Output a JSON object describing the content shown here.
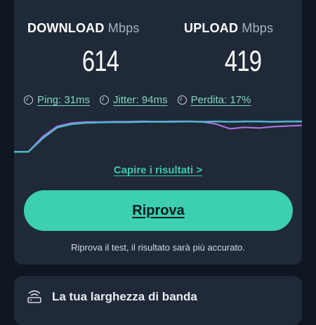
{
  "download": {
    "label": "DOWNLOAD",
    "unit": "Mbps",
    "value": "614"
  },
  "upload": {
    "label": "UPLOAD",
    "unit": "Mbps",
    "value": "419"
  },
  "stats": {
    "ping": "Ping: 31ms",
    "jitter": "Jitter: 94ms",
    "loss": "Perdita: 17%"
  },
  "understand_link": "Capire i risultati >",
  "retry_button": "Riprova",
  "retry_hint": "Riprova il test, il risultato sarà più accurato.",
  "bandwidth_card": {
    "title": "La tua larghezza di banda",
    "icon": "router-icon"
  },
  "colors": {
    "accent": "#3ccfb0",
    "download_line": "#5aa8e0",
    "upload_line": "#b675e8",
    "card_bg": "#1f2937",
    "page_bg": "#0e1621"
  },
  "chart_data": {
    "type": "line",
    "x": [
      0,
      1,
      2,
      3,
      4,
      5,
      6,
      7,
      8,
      9,
      10,
      11,
      12,
      13,
      14,
      15,
      16,
      17,
      18,
      19,
      20
    ],
    "series": [
      {
        "values": [
          0,
          0,
          40,
          72,
          82,
          86,
          87,
          88,
          88,
          89,
          89,
          89,
          90,
          89,
          90,
          89,
          90,
          90,
          89,
          90,
          90
        ]
      },
      {
        "values": [
          0,
          0,
          45,
          75,
          85,
          88,
          88,
          89,
          89,
          90,
          89,
          90,
          90,
          89,
          82,
          68,
          72,
          70,
          74,
          76,
          78
        ]
      }
    ],
    "ylim": [
      0,
      100
    ],
    "grid": false
  }
}
